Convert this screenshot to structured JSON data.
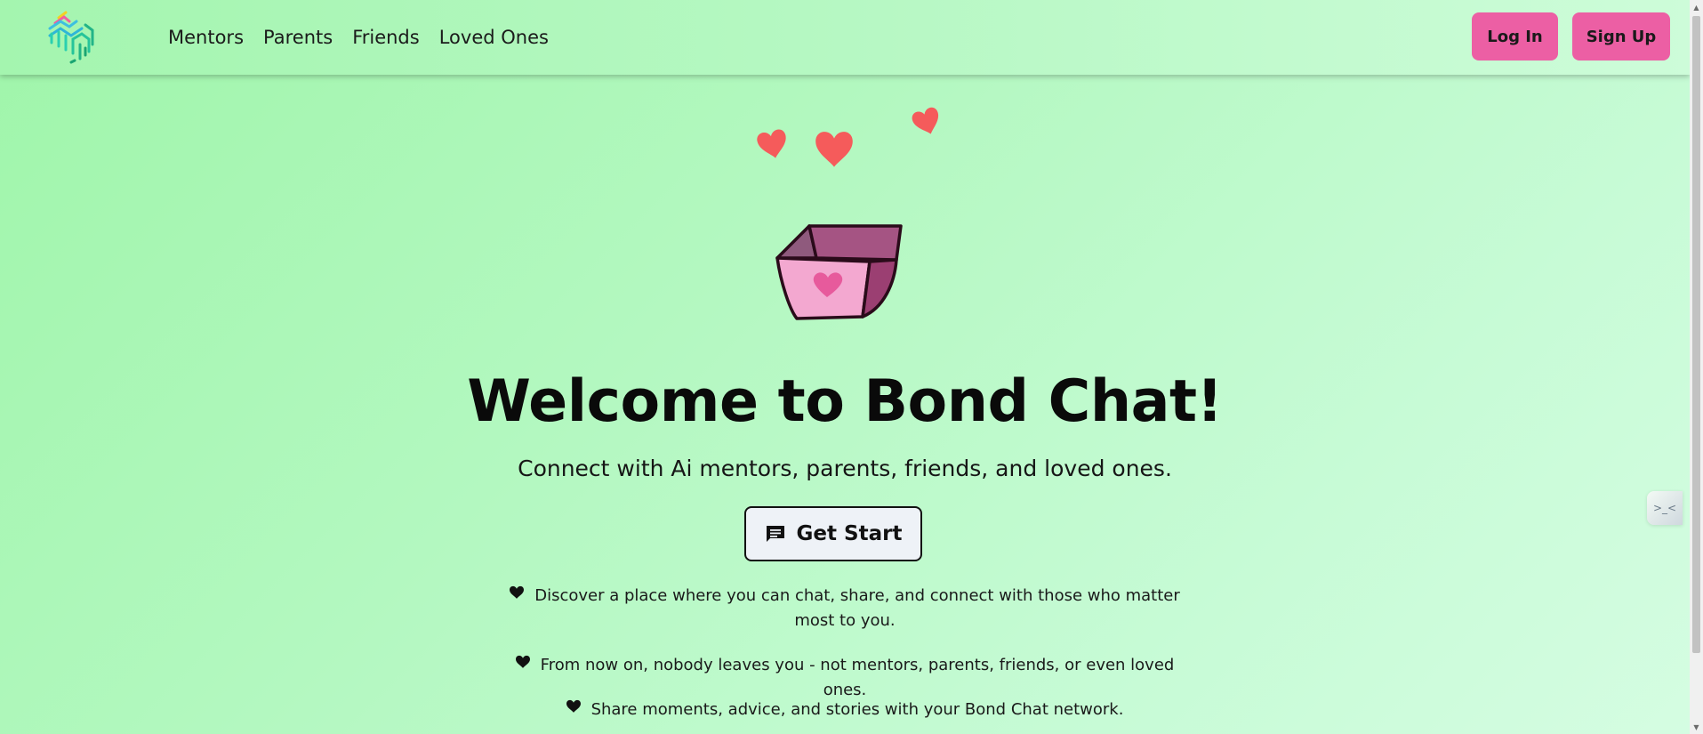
{
  "nav": {
    "links": [
      "Mentors",
      "Parents",
      "Friends",
      "Loved Ones"
    ],
    "login_label": "Log In",
    "signup_label": "Sign Up"
  },
  "hero": {
    "title": "Welcome to Bond Chat!",
    "subtitle": "Connect with Ai mentors, parents, friends, and loved ones.",
    "cta_label": "Get Start",
    "bullets": [
      "Discover a place where you can chat, share, and connect with those who matter most to you.",
      "From now on, nobody leaves you - not mentors, parents, friends, or even loved ones.",
      "Share moments, advice, and stories with your Bond Chat network."
    ]
  },
  "side_widget": {
    "label": ">_<"
  },
  "colors": {
    "brand_pink": "#ec5fa4",
    "heart_red": "#f55b5b",
    "background_green": "#a8f6b4"
  }
}
